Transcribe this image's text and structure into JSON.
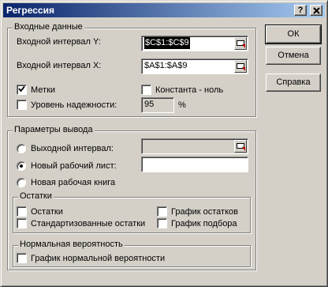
{
  "window": {
    "title": "Регрессия",
    "help_btn": "?",
    "close_btn": "X"
  },
  "input_group": {
    "legend": "Входные данные",
    "y_label": "Входной интервал Y:",
    "y_value": "$C$1:$C$9",
    "x_label": "Входной интервал X:",
    "x_value": "$A$1:$A$9",
    "labels_label": "Метки",
    "labels_checked": true,
    "constant_label": "Константа - ноль",
    "constant_checked": false,
    "confidence_label": "Уровень надежности:",
    "confidence_checked": false,
    "confidence_value": "95",
    "confidence_unit": "%"
  },
  "output_group": {
    "legend": "Параметры вывода",
    "output_range_label": "Выходной интервал:",
    "output_range_value": "",
    "new_sheet_label": "Новый рабочий лист:",
    "new_sheet_value": "",
    "new_workbook_label": "Новая рабочая книга",
    "selected": "new_sheet"
  },
  "residuals_group": {
    "legend": "Остатки",
    "residuals_label": "Остатки",
    "std_residuals_label": "Стандартизованные остатки",
    "residual_plot_label": "График остатков",
    "fit_plot_label": "График подбора"
  },
  "normal_group": {
    "legend": "Нормальная вероятность",
    "normal_plot_label": "График нормальной вероятности"
  },
  "buttons": {
    "ok": "ОК",
    "cancel": "Отмена",
    "help": "Справка"
  },
  "icons": {
    "collapse": "collapse-dialog-icon",
    "check": "checkmark-icon"
  }
}
